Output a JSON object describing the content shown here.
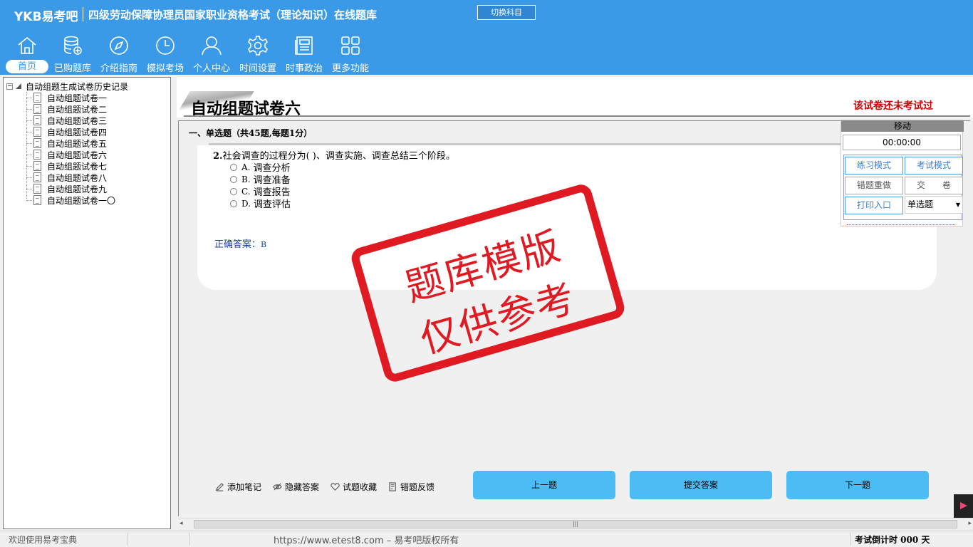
{
  "header": {
    "logo": "YKB易考吧",
    "title": "四级劳动保障协理员国家职业资格考试（理论知识）在线题库",
    "switch_button": "切换科目"
  },
  "nav": [
    {
      "label": "首页",
      "icon": "home-icon"
    },
    {
      "label": "已购题库",
      "icon": "database-icon"
    },
    {
      "label": "介绍指南",
      "icon": "compass-icon"
    },
    {
      "label": "模拟考场",
      "icon": "clock-icon"
    },
    {
      "label": "个人中心",
      "icon": "user-icon"
    },
    {
      "label": "时间设置",
      "icon": "gear-icon"
    },
    {
      "label": "时事政治",
      "icon": "newspaper-icon"
    },
    {
      "label": "更多功能",
      "icon": "grid-icon"
    }
  ],
  "tree": {
    "root": "自动组题生成试卷历史记录",
    "items": [
      "自动组题试卷一",
      "自动组题试卷二",
      "自动组题试卷三",
      "自动组题试卷四",
      "自动组题试卷五",
      "自动组题试卷六",
      "自动组题试卷七",
      "自动组题试卷八",
      "自动组题试卷九",
      "自动组题试卷一〇"
    ]
  },
  "paper": {
    "title": "自动组题试卷六",
    "status": "该试卷还未考试过",
    "section": "一、单选题（共45题,每题1分）"
  },
  "question": {
    "number": "2.",
    "text": "社会调查的过程分为( )、调查实施、调查总结三个阶段。",
    "options": [
      {
        "key": "A.",
        "text": "调查分析"
      },
      {
        "key": "B.",
        "text": "调查准备"
      },
      {
        "key": "C.",
        "text": "调查报告"
      },
      {
        "key": "D.",
        "text": "调查评估"
      }
    ],
    "answer_label": "正确答案：",
    "answer_value": "B"
  },
  "stamp": {
    "line1": "题库模版",
    "line2": "仅供参考"
  },
  "tools": [
    {
      "label": "添加笔记",
      "icon": "pencil-icon"
    },
    {
      "label": "隐藏答案",
      "icon": "eye-icon"
    },
    {
      "label": "试题收藏",
      "icon": "heart-icon"
    },
    {
      "label": "错题反馈",
      "icon": "feedback-icon"
    }
  ],
  "buttons": {
    "prev": "上一题",
    "submit": "提交答案",
    "next": "下一题"
  },
  "side_panel": {
    "move": "移动",
    "timer": "00:00:00",
    "practice_mode": "练习模式",
    "exam_mode": "考试模式",
    "redo_wrong": "错题重做",
    "submit_paper": "交　　卷",
    "print": "打印入口",
    "question_type": "单选题"
  },
  "statusbar": {
    "welcome": "欢迎使用易考宝典",
    "copyright": "https://www.etest8.com – 易考吧版权所有",
    "countdown": "考试倒计时 000 天"
  },
  "colors": {
    "header_bg": "#3b9ae7",
    "button_bg": "#4cbcf5",
    "stamp": "#e01a22",
    "status_red": "#d20000"
  }
}
